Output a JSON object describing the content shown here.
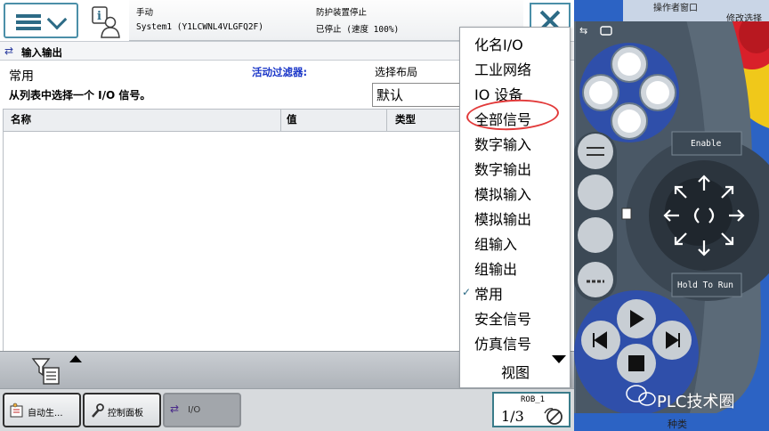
{
  "status": {
    "mode": "手动",
    "system": "System1 (Y1LCWNL4VLGFQ2F)",
    "safety": "防护装置停止",
    "state": "已停止 (速度 100%)"
  },
  "title": "输入输出",
  "panel": {
    "category": "常用",
    "hint": "从列表中选择一个 I/O 信号。",
    "filter_label": "活动过滤器:",
    "layout_label": "选择布局",
    "layout_value": "默认"
  },
  "table": {
    "headers": [
      "名称",
      "值",
      "类型"
    ]
  },
  "menu": {
    "items": [
      "化名I/O",
      "工业网络",
      "IO 设备",
      "全部信号",
      "数字输入",
      "数字输出",
      "模拟输入",
      "模拟输出",
      "组输入",
      "组输出",
      "常用",
      "安全信号",
      "仿真信号"
    ],
    "checked": "常用",
    "view": "视图"
  },
  "taskbar": {
    "items": [
      "自动生...",
      "控制面板",
      "I/O"
    ],
    "rob": "ROB_1",
    "fraction": "1/3"
  },
  "pendant": {
    "window_text": "操作者窗口",
    "button_text": "修改选择",
    "enable": "Enable",
    "hold_to_run": "Hold To Run",
    "watermark": "PLC技术圈",
    "bottom_text": "种类"
  },
  "colors": {
    "accent": "#2d6b86",
    "filter_blue": "#1a36c8",
    "annotation_red": "#e23a3a",
    "pendant_blue": "#2c63c4"
  }
}
